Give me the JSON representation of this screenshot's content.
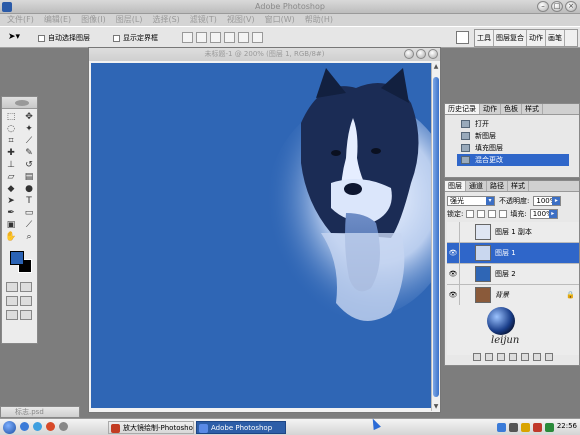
{
  "app": {
    "title": "Adobe Photoshop"
  },
  "menu": [
    "文件(F)",
    "编辑(E)",
    "图像(I)",
    "图层(L)",
    "选择(S)",
    "滤镜(T)",
    "视图(V)",
    "窗口(W)",
    "帮助(H)"
  ],
  "options": {
    "auto_select_layer": "自动选择图层",
    "show_bounding_box": "显示定界框",
    "palette_well": [
      "工具",
      "图层复合",
      "动作",
      "画笔"
    ]
  },
  "document": {
    "title": "未标题-1 @ 200% (图层 1, RGB/8#)",
    "canvas_color": "#2f66b5"
  },
  "history": {
    "tabs": [
      "历史记录",
      "动作",
      "色板",
      "样式"
    ],
    "items": [
      "打开",
      "新图层",
      "填充图层",
      "混合更改"
    ],
    "active_index": 3
  },
  "layers": {
    "tabs": [
      "图层",
      "通道",
      "路径",
      "样式"
    ],
    "blend_mode": "强光",
    "opacity_label": "不透明度:",
    "opacity_value": "100%",
    "lock_label": "锁定:",
    "fill_label": "填充:",
    "fill_value": "100%",
    "rows": [
      {
        "name": "图层 1 副本",
        "active": false,
        "thumb": "#dfe6f3"
      },
      {
        "name": "图层 1",
        "active": true,
        "thumb": "#c9d7ef"
      },
      {
        "name": "图层 2",
        "active": false,
        "thumb": "#2f66b5"
      },
      {
        "name": "背景",
        "active": false,
        "thumb": "#8a5a3a"
      }
    ],
    "logo_text": "leijun"
  },
  "minimized_window": {
    "title": "标志.psd"
  },
  "taskbar": {
    "items": [
      {
        "label": "放大镜绘制-Photoshop",
        "active": false,
        "icon_color": "#c23b22"
      },
      {
        "label": "Adobe Photoshop",
        "active": true,
        "icon_color": "#5a8ae6"
      }
    ],
    "clock": "22:56"
  },
  "colors": {
    "accent": "#2f66c9",
    "foreground": "#2b63b5",
    "background": "#000000"
  }
}
